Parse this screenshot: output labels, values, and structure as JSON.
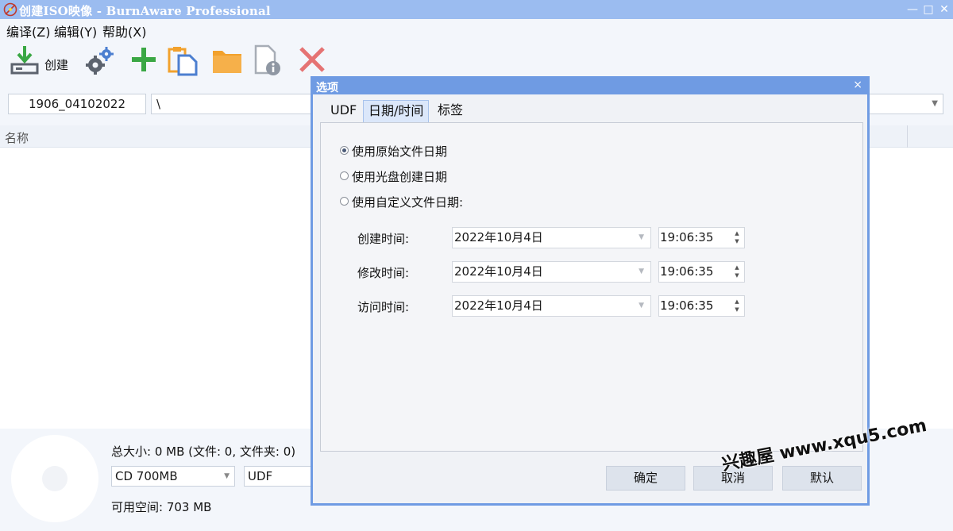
{
  "window": {
    "title": "创建ISO映像 - BurnAware Professional",
    "minimize_glyph": "—",
    "maximize_glyph": "□",
    "close_glyph": "✕"
  },
  "menu": {
    "items": [
      "编译(Z)",
      "编辑(Y)",
      "帮助(X)"
    ]
  },
  "toolbar": {
    "create_label": "创建",
    "icons": [
      "create-download-icon",
      "settings-gears-icon",
      "add-plus-icon",
      "paste-clipboard-icon",
      "folder-icon",
      "file-info-icon",
      "delete-x-icon"
    ],
    "colors": {
      "green": "#3aa744",
      "orange": "#f2a12c",
      "red": "#e57373",
      "gray": "#5c636e"
    }
  },
  "pathbar": {
    "volume_label": "1906_04102022",
    "path": "\\"
  },
  "list": {
    "column_name": "名称"
  },
  "status": {
    "total_size": "总大小: 0 MB (文件: 0, 文件夹: 0)",
    "disc_type": "CD 700MB",
    "filesystem": "UDF",
    "free_space": "可用空间: 703 MB"
  },
  "dialog": {
    "title": "选项",
    "close_glyph": "×",
    "tabs": [
      "UDF",
      "日期/时间",
      "标签"
    ],
    "active_tab": "日期/时间",
    "options": [
      "使用原始文件日期",
      "使用光盘创建日期",
      "使用自定义文件日期:"
    ],
    "selected_option": 0,
    "fields": [
      {
        "label": "创建时间:",
        "date": "2022年10月4日",
        "time": "19:06:35"
      },
      {
        "label": "修改时间:",
        "date": "2022年10月4日",
        "time": "19:06:35"
      },
      {
        "label": "访问时间:",
        "date": "2022年10月4日",
        "time": "19:06:35"
      }
    ],
    "buttons": {
      "ok": "确定",
      "cancel": "取消",
      "default": "默认"
    }
  },
  "watermark": "兴趣屋 www.xqu5.com"
}
